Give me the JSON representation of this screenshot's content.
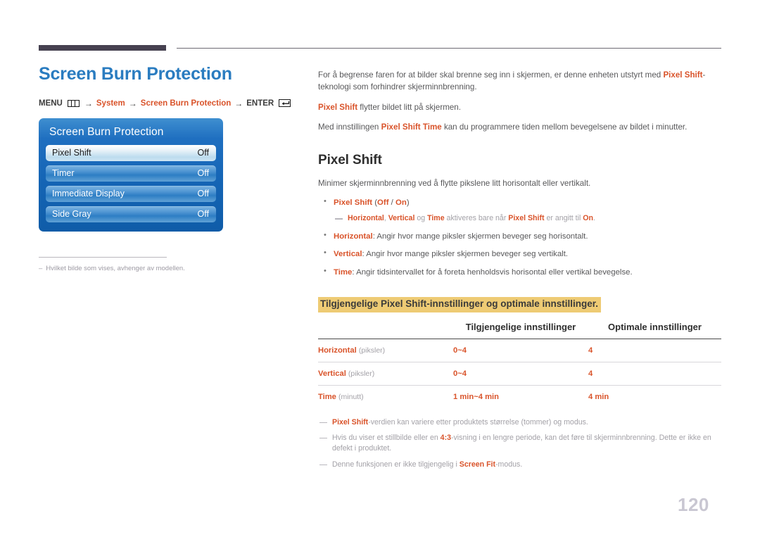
{
  "document": {
    "page_number": "120"
  },
  "left": {
    "title": "Screen Burn Protection",
    "breadcrumb": {
      "menu_label": "MENU",
      "menu_icon": "menu-bars-icon",
      "arrow": "→",
      "item1": "System",
      "item2": "Screen Burn Protection",
      "enter_label": "ENTER",
      "enter_icon": "enter-return-icon"
    },
    "osd": {
      "title": "Screen Burn Protection",
      "rows": [
        {
          "label": "Pixel Shift",
          "value": "Off",
          "selected": true
        },
        {
          "label": "Timer",
          "value": "Off",
          "selected": false
        },
        {
          "label": "Immediate Display",
          "value": "Off",
          "selected": false
        },
        {
          "label": "Side Gray",
          "value": "Off",
          "selected": false
        }
      ]
    },
    "note": {
      "dash": "–",
      "text": "Hvilket bilde som vises, avhenger av modellen."
    }
  },
  "right": {
    "intro": {
      "p1_a": "For å begrense faren for at bilder skal brenne seg inn i skjermen, er denne enheten utstyrt med ",
      "p1_accent": "Pixel Shift",
      "p1_b": "-teknologi som forhindrer skjerminnbrenning.",
      "p2_accent": "Pixel Shift",
      "p2_b": " flytter bildet litt på skjermen.",
      "p3_a": "Med innstillingen ",
      "p3_accent": "Pixel Shift Time",
      "p3_b": " kan du programmere tiden mellom bevegelsene av bildet i minutter."
    },
    "section": {
      "title": "Pixel Shift",
      "lead": "Minimer skjerminnbrenning ved å flytte pikslene litt horisontalt eller vertikalt."
    },
    "bullets": [
      {
        "accent": "Pixel Shift",
        "rest_open": " (",
        "opt1": "Off",
        "sep": " / ",
        "opt2": "On",
        "rest_close": ")"
      },
      {
        "accent": "Horizontal",
        "rest": ": Angir hvor mange piksler skjermen beveger seg horisontalt."
      },
      {
        "accent": "Vertical",
        "rest": ": Angir hvor mange piksler skjermen beveger seg vertikalt."
      },
      {
        "accent": "Time",
        "rest": ": Angir tidsintervallet for å foreta henholdsvis horisontal eller vertikal bevegelse."
      }
    ],
    "subnote_top": {
      "a1": "Horizontal",
      "t1": ", ",
      "a2": "Vertical",
      "t2": " og ",
      "a3": "Time",
      "t3": " aktiveres bare når ",
      "a4": "Pixel Shift",
      "t4": " er angitt til ",
      "a5": "On",
      "t5": "."
    },
    "highlight_heading": "Tilgjengelige Pixel Shift-innstillinger og optimale innstillinger.",
    "table": {
      "headers": [
        "",
        "Tilgjengelige innstillinger",
        "Optimale innstillinger"
      ],
      "rows": [
        {
          "label": "Horizontal",
          "unit": "(piksler)",
          "available": "0~4",
          "optimal": "4"
        },
        {
          "label": "Vertical",
          "unit": "(piksler)",
          "available": "0~4",
          "optimal": "4"
        },
        {
          "label": "Time",
          "unit": "(minutt)",
          "available": "1 min~4 min",
          "optimal": "4 min"
        }
      ]
    },
    "footnotes": [
      {
        "a1": "Pixel Shift",
        "t1": "-verdien kan variere etter produktets størrelse (tommer) og modus."
      },
      {
        "t0": "Hvis du viser et stillbilde eller en ",
        "a1": "4:3",
        "t1": "-visning i en lengre periode, kan det føre til skjerminnbrenning. Dette er ikke en defekt i produktet."
      },
      {
        "t0": "Denne funksjonen er ikke tilgjengelig i ",
        "a1": "Screen Fit",
        "t1": "-modus."
      }
    ]
  }
}
